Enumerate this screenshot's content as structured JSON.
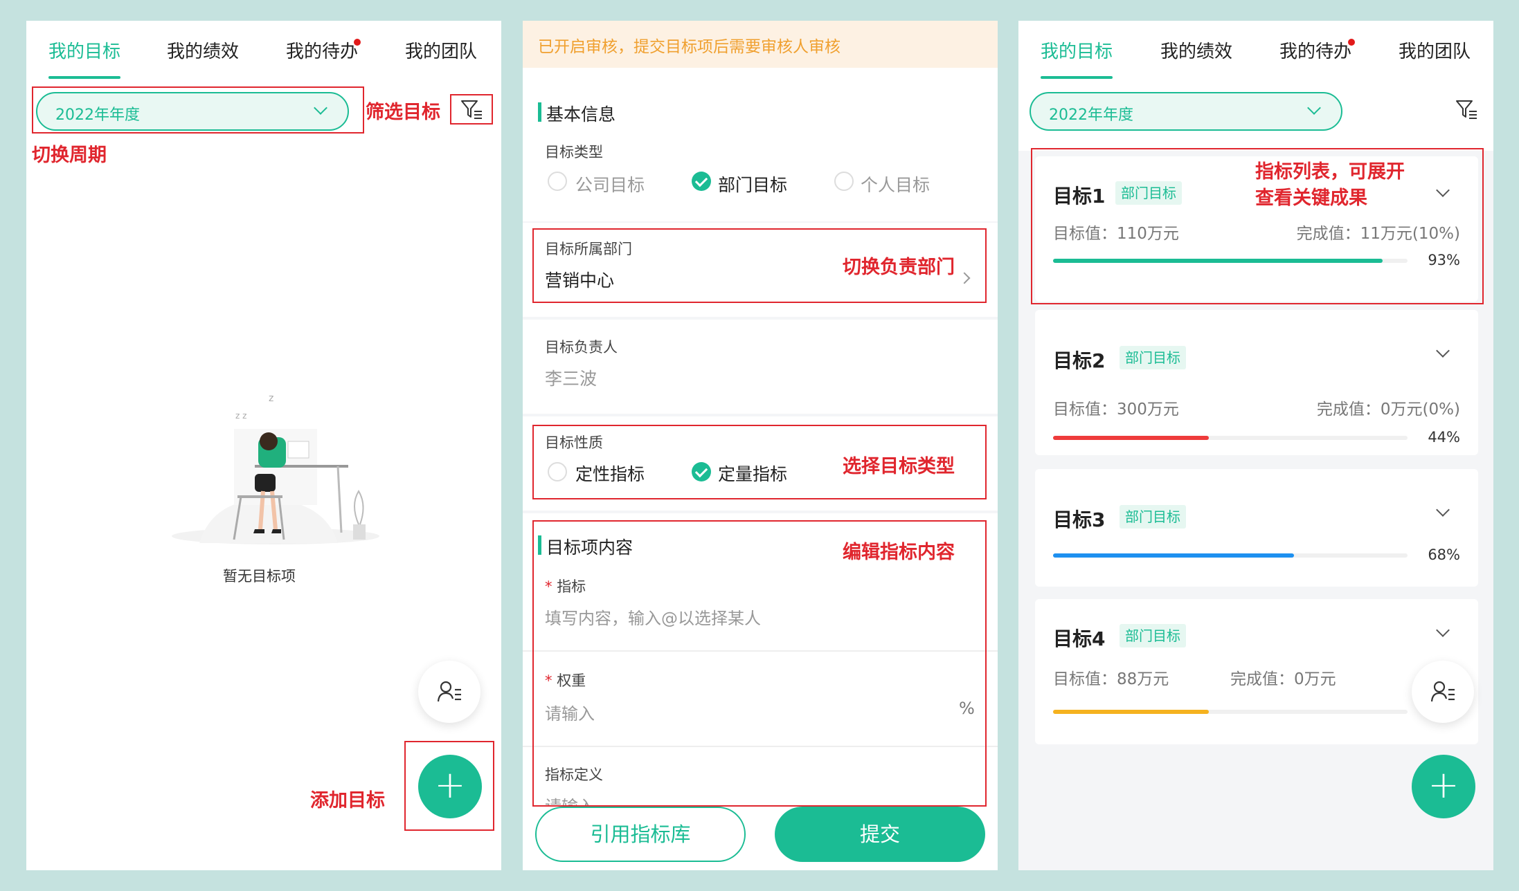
{
  "tabs": [
    "我的目标",
    "我的绩效",
    "我的待办",
    "我的团队"
  ],
  "colors": {
    "accent": "#1bbc94",
    "annotation": "#e0262e",
    "notice": "#f0a02f",
    "dot": "#e21a1a"
  },
  "panel1": {
    "period": "2022年年度",
    "annotations": {
      "filter": "筛选目标",
      "period": "切换周期",
      "add": "添加目标"
    },
    "empty_text": "暂无目标项",
    "icons": [
      "filter-icon",
      "person-list-icon",
      "plus-icon",
      "sleeping-illustration"
    ]
  },
  "panel2": {
    "notice": "已开启审核，提交目标项后需要审核人审核",
    "basic_title": "基本信息",
    "type_label": "目标类型",
    "type_options": [
      "公司目标",
      "部门目标",
      "个人目标"
    ],
    "type_selected": "部门目标",
    "dept_label": "目标所属部门",
    "dept_value": "营销中心",
    "dept_annotation": "切换负责部门",
    "owner_label": "目标负责人",
    "owner_value": "李三波",
    "nature_label": "目标性质",
    "nature_options": [
      "定性指标",
      "定量指标"
    ],
    "nature_selected": "定量指标",
    "nature_annotation": "选择目标类型",
    "content_title": "目标项内容",
    "content_annotation": "编辑指标内容",
    "indicator_label": "指标",
    "indicator_placeholder": "填写内容，输入@以选择某人",
    "weight_label": "权重",
    "weight_placeholder": "请输入",
    "weight_unit": "%",
    "definition_label": "指标定义",
    "definition_placeholder": "请输入",
    "required_mark": "*",
    "btn_library": "引用指标库",
    "btn_submit": "提交"
  },
  "panel3": {
    "period": "2022年年度",
    "list_annotation_line1": "指标列表，可展开",
    "list_annotation_line2": "查看关键成果",
    "goals": [
      {
        "title": "目标1",
        "badge": "部门目标",
        "target": "目标值：110万元",
        "done": "完成值：11万元(10%)",
        "percent": 93,
        "percent_label": "93%",
        "color": "#1bbc94"
      },
      {
        "title": "目标2",
        "badge": "部门目标",
        "target": "目标值：300万元",
        "done": "完成值：0万元(0%)",
        "percent": 44,
        "percent_label": "44%",
        "color": "#ee3b3b"
      },
      {
        "title": "目标3",
        "badge": "部门目标",
        "target": "",
        "done": "",
        "percent": 68,
        "percent_label": "68%",
        "color": "#1e90f0"
      },
      {
        "title": "目标4",
        "badge": "部门目标",
        "target": "目标值：88万元",
        "done": "完成值：0万元",
        "percent": 44,
        "percent_label": "",
        "color": "#f5b21f"
      }
    ]
  }
}
